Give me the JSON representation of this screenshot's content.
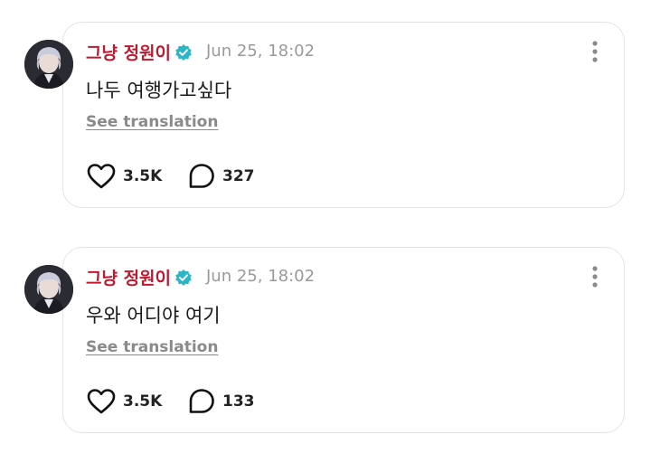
{
  "posts": [
    {
      "author": "그냥 정원이",
      "time": "Jun 25, 18:02",
      "text": "나두 여행가고싶다",
      "translate_label": "See translation",
      "likes": "3.5K",
      "comments": "327"
    },
    {
      "author": "그냥 정원이",
      "time": "Jun 25, 18:02",
      "text": "우와 어디야 여기",
      "translate_label": "See translation",
      "likes": "3.5K",
      "comments": "133"
    }
  ],
  "colors": {
    "author": "#c0182f",
    "verified": "#29b6c6",
    "muted": "#9a9a9a",
    "border": "#e3e3e3"
  },
  "icons": {
    "verified": "verified-badge-icon",
    "more": "more-vertical-icon",
    "like": "heart-icon",
    "comment": "comment-bubble-icon"
  }
}
